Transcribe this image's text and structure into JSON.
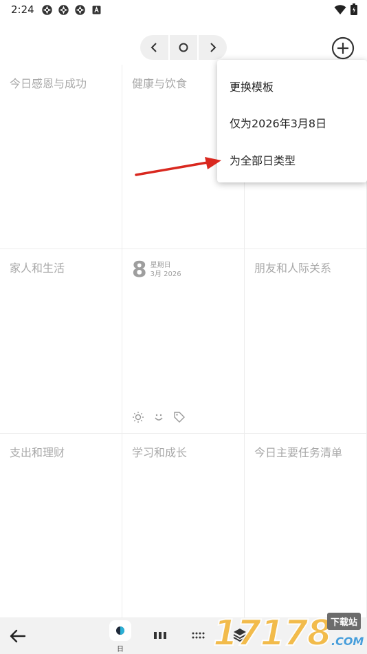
{
  "status_bar": {
    "time": "2:24",
    "left_icons": [
      "aperture-icon",
      "aperture-icon",
      "aperture-icon",
      "font-a-icon"
    ],
    "right_icons": [
      "wifi-icon",
      "battery-icon"
    ]
  },
  "nav": {
    "prev_icon": "chevron-left-icon",
    "today_icon": "circle-icon",
    "next_icon": "chevron-right-icon",
    "add_icon": "plus-circle-icon"
  },
  "grid": {
    "cells": [
      {
        "title": "今日感恩与成功"
      },
      {
        "title": "健康与饮食"
      },
      {
        "title": ""
      },
      {
        "title": "家人和生活"
      },
      {
        "title": ""
      },
      {
        "title": "朋友和人际关系"
      },
      {
        "title": "支出和理财"
      },
      {
        "title": "学习和成长"
      },
      {
        "title": "今日主要任务清单"
      }
    ],
    "center": {
      "day": "8",
      "weekday": "星期日",
      "month_year": "3月 2026",
      "icons": [
        "sun-icon",
        "smiley-icon",
        "tag-icon"
      ]
    }
  },
  "popup_menu": {
    "items": [
      "更换模板",
      "仅为2026年3月8日",
      "为全部日类型"
    ]
  },
  "bottom_bar": {
    "back_icon": "arrow-left-icon",
    "day_label": "日",
    "tabs": [
      "day-icon",
      "week-icon",
      "month-icon",
      "layers-icon"
    ]
  },
  "watermark": {
    "digits": "17178",
    "badge": "下载站",
    "suffix": ".COM"
  },
  "colors": {
    "arrow": "#d9281f",
    "watermark_digits": "#f2b63a",
    "watermark_com": "#2a90d8"
  }
}
